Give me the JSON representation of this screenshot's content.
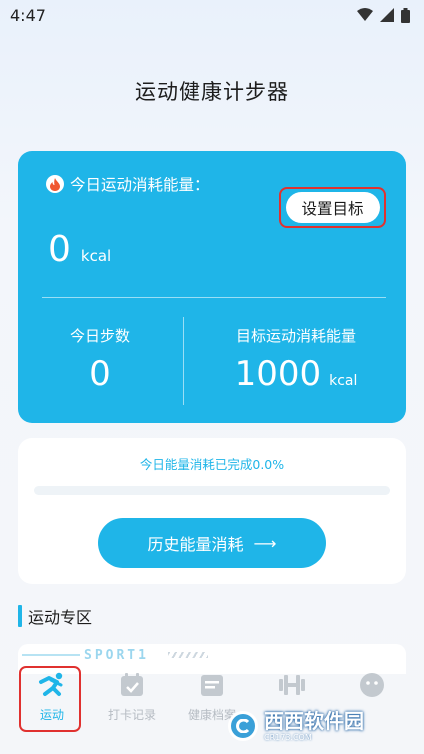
{
  "status_bar": {
    "time": "4:47",
    "icons": [
      "wifi-icon",
      "signal-icon",
      "battery-icon"
    ]
  },
  "app": {
    "title": "运动健康计步器"
  },
  "energy_card": {
    "heading": "今日运动消耗能量：",
    "set_goal_label": "设置目标",
    "today_kcal_value": "0",
    "kcal_unit": "kcal",
    "steps_label": "今日步数",
    "steps_value": "0",
    "target_label": "目标运动消耗能量",
    "target_value": "1000",
    "target_unit": "kcal"
  },
  "progress": {
    "text": "今日能量消耗已完成0.0%",
    "percent": 0.0,
    "history_button_label": "历史能量消耗",
    "arrow": "⟶"
  },
  "section": {
    "title": "运动专区",
    "banner_word": "SPORT1"
  },
  "bottom_nav": {
    "items": [
      {
        "label": "运动",
        "icon": "running-icon",
        "active": true
      },
      {
        "label": "打卡记录",
        "icon": "calendar-check-icon",
        "active": false
      },
      {
        "label": "健康档案",
        "icon": "health-file-icon",
        "active": false
      },
      {
        "label": "",
        "icon": "dumbbell-icon",
        "active": false
      },
      {
        "label": "",
        "icon": "smiley-icon",
        "active": false
      }
    ]
  },
  "watermark": {
    "brand": "西西软件园",
    "site": "CR173.COM"
  },
  "colors": {
    "accent": "#1fb5e8",
    "highlight": "#e0312f",
    "inactive": "#b6bcc3"
  }
}
